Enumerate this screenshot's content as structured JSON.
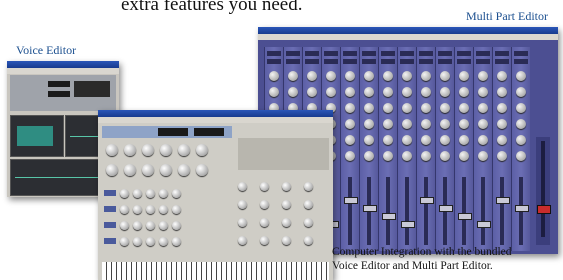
{
  "headline": "extra features you need.",
  "labels": {
    "multi_part_editor": "Multi Part Editor",
    "voice_editor": "Voice Editor"
  },
  "caption": {
    "line1": "Computer Integration with the bundled",
    "line2": "Voice Editor and Multi Part Editor."
  },
  "colors": {
    "label_blue": "#1b4f8f",
    "mixer_purple": "#4c4f92",
    "titlebar_blue": "#2a56b8"
  }
}
